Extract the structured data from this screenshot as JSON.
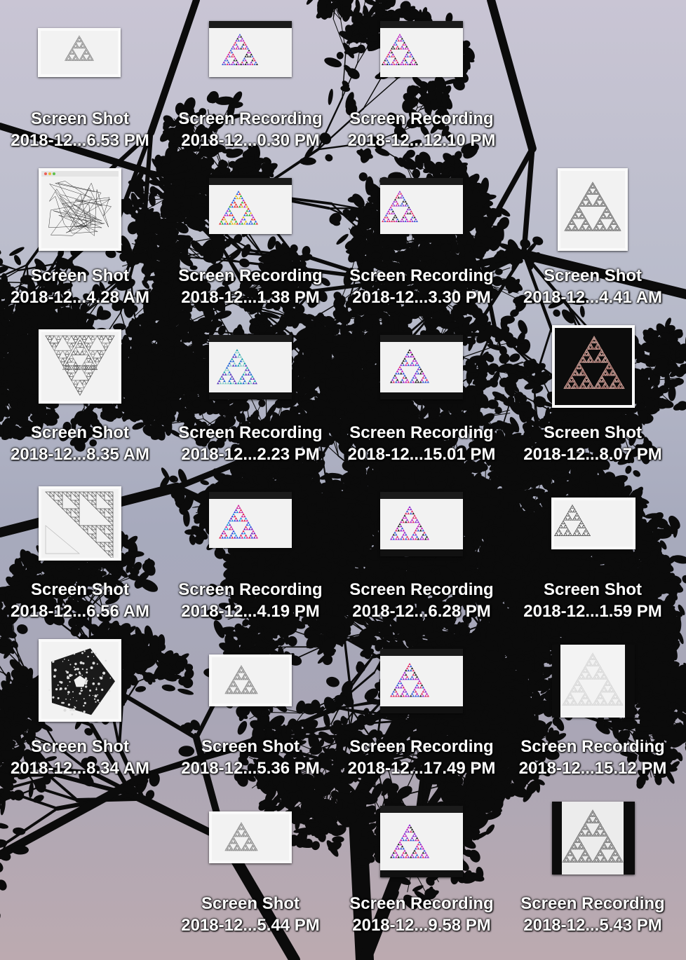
{
  "desktop": {
    "items": [
      {
        "name": "Screen Shot",
        "date": "2018-12...6.53 PM",
        "thumb": "sierpinski-outline",
        "kind": "shot"
      },
      {
        "name": "Screen Recording",
        "date": "2018-12...0.30 PM",
        "thumb": "sierpinski-color",
        "kind": "rec-top"
      },
      {
        "name": "Screen Recording",
        "date": "2018-12...12.10 PM",
        "thumb": "sierpinski-color",
        "kind": "rec-top"
      },
      {
        "name": "Screen Shot",
        "date": "2018-12...4.28 AM",
        "thumb": "chaos-lines",
        "kind": "shot"
      },
      {
        "name": "Screen Recording",
        "date": "2018-12...1.38 PM",
        "thumb": "sierpinski-rainbow",
        "kind": "rec-top"
      },
      {
        "name": "Screen Recording",
        "date": "2018-12...3.30 PM",
        "thumb": "sierpinski-color",
        "kind": "rec-top"
      },
      {
        "name": "Screen Shot",
        "date": "2018-12...4.41 AM",
        "thumb": "sierpinski-gray",
        "kind": "shot"
      },
      {
        "name": "Screen Shot",
        "date": "2018-12...8.35 AM",
        "thumb": "sierpinski-inverted",
        "kind": "shot"
      },
      {
        "name": "Screen Recording",
        "date": "2018-12...2.23 PM",
        "thumb": "sierpinski-teal",
        "kind": "rec-both"
      },
      {
        "name": "Screen Recording",
        "date": "2018-12...15.01 PM",
        "thumb": "sierpinski-color",
        "kind": "rec-both"
      },
      {
        "name": "Screen Shot",
        "date": "2018-12...8.07 PM",
        "thumb": "sierpinski-dark",
        "kind": "shot"
      },
      {
        "name": "Screen Shot",
        "date": "2018-12...6.56 AM",
        "thumb": "sierpinski-right",
        "kind": "shot"
      },
      {
        "name": "Screen Recording",
        "date": "2018-12...4.19 PM",
        "thumb": "sierpinski-noise",
        "kind": "rec-top"
      },
      {
        "name": "Screen Recording",
        "date": "2018-12...6.28 PM",
        "thumb": "sierpinski-color",
        "kind": "rec-both"
      },
      {
        "name": "Screen Shot",
        "date": "2018-12...1.59 PM",
        "thumb": "sierpinski-black",
        "kind": "shot"
      },
      {
        "name": "Screen Shot",
        "date": "2018-12...8.34 AM",
        "thumb": "pentagon-fractal",
        "kind": "shot"
      },
      {
        "name": "Screen Shot",
        "date": "2018-12...5.36 PM",
        "thumb": "sierpinski-outline",
        "kind": "shot"
      },
      {
        "name": "Screen Recording",
        "date": "2018-12...17.49 PM",
        "thumb": "sierpinski-color",
        "kind": "rec-both"
      },
      {
        "name": "Screen Recording",
        "date": "2018-12...15.12 PM",
        "thumb": "sierpinski-faint",
        "kind": "rec-sides"
      },
      {
        "name": "Screen Shot",
        "date": "2018-12...5.44 PM",
        "thumb": "sierpinski-outline",
        "kind": "shot"
      },
      {
        "name": "Screen Recording",
        "date": "2018-12...9.58 PM",
        "thumb": "sierpinski-color",
        "kind": "rec-both"
      },
      {
        "name": "Screen Recording",
        "date": "2018-12...5.43 PM",
        "thumb": "sierpinski-gray",
        "kind": "rec-sides"
      }
    ]
  },
  "colors": {
    "label_text": "#ffffff",
    "label_shadow": "#000000",
    "tree_silhouette": "#0b0b0b",
    "thumb_bg": "#f2f2f2"
  }
}
